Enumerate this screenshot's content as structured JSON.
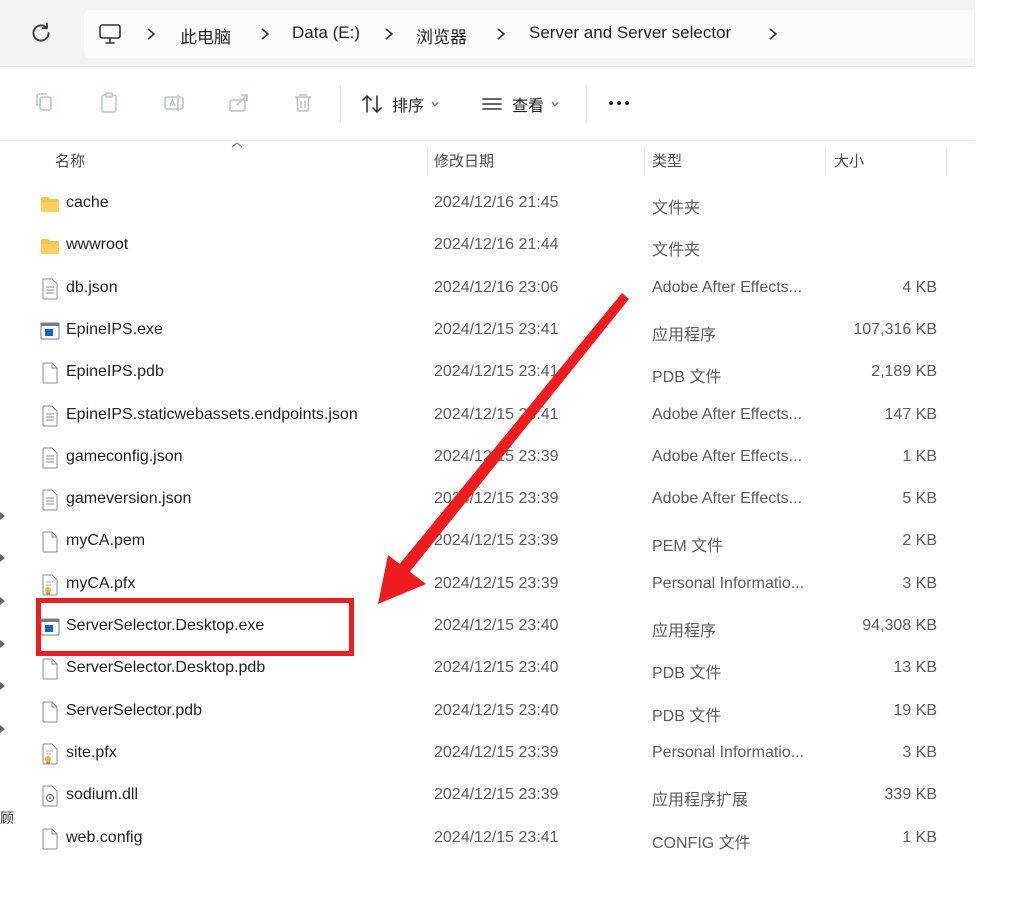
{
  "breadcrumb": [
    "此电脑",
    "Data (E:)",
    "浏览器",
    "Server and Server selector"
  ],
  "toolbar": {
    "sort_label": "排序",
    "view_label": "查看"
  },
  "columns": {
    "name": "名称",
    "modified": "修改日期",
    "type": "类型",
    "size": "大小"
  },
  "files": [
    {
      "name": "cache",
      "date": "2024/12/16 21:45",
      "type": "文件夹",
      "size": "",
      "icon": "folder-icon"
    },
    {
      "name": "wwwroot",
      "date": "2024/12/16 21:44",
      "type": "文件夹",
      "size": "",
      "icon": "folder-icon"
    },
    {
      "name": "db.json",
      "date": "2024/12/16 23:06",
      "type": "Adobe After Effects...",
      "size": "4 KB",
      "icon": "json-file-icon"
    },
    {
      "name": "EpineIPS.exe",
      "date": "2024/12/15 23:41",
      "type": "应用程序",
      "size": "107,316 KB",
      "icon": "exe-file-icon"
    },
    {
      "name": "EpineIPS.pdb",
      "date": "2024/12/15 23:41",
      "type": "PDB 文件",
      "size": "2,189 KB",
      "icon": "blank-file-icon"
    },
    {
      "name": "EpineIPS.staticwebassets.endpoints.json",
      "date": "2024/12/15 23:41",
      "type": "Adobe After Effects...",
      "size": "147 KB",
      "icon": "json-file-icon"
    },
    {
      "name": "gameconfig.json",
      "date": "2024/12/15 23:39",
      "type": "Adobe After Effects...",
      "size": "1 KB",
      "icon": "json-file-icon"
    },
    {
      "name": "gameversion.json",
      "date": "2024/12/15 23:39",
      "type": "Adobe After Effects...",
      "size": "5 KB",
      "icon": "json-file-icon"
    },
    {
      "name": "myCA.pem",
      "date": "2024/12/15 23:39",
      "type": "PEM 文件",
      "size": "2 KB",
      "icon": "blank-file-icon"
    },
    {
      "name": "myCA.pfx",
      "date": "2024/12/15 23:39",
      "type": "Personal Informatio...",
      "size": "3 KB",
      "icon": "certificate-file-icon"
    },
    {
      "name": "ServerSelector.Desktop.exe",
      "date": "2024/12/15 23:40",
      "type": "应用程序",
      "size": "94,308 KB",
      "icon": "exe-file-icon"
    },
    {
      "name": "ServerSelector.Desktop.pdb",
      "date": "2024/12/15 23:40",
      "type": "PDB 文件",
      "size": "13 KB",
      "icon": "blank-file-icon"
    },
    {
      "name": "ServerSelector.pdb",
      "date": "2024/12/15 23:40",
      "type": "PDB 文件",
      "size": "19 KB",
      "icon": "blank-file-icon"
    },
    {
      "name": "site.pfx",
      "date": "2024/12/15 23:39",
      "type": "Personal Informatio...",
      "size": "3 KB",
      "icon": "certificate-file-icon"
    },
    {
      "name": "sodium.dll",
      "date": "2024/12/15 23:39",
      "type": "应用程序扩展",
      "size": "339 KB",
      "icon": "dll-file-icon"
    },
    {
      "name": "web.config",
      "date": "2024/12/15 23:41",
      "type": "CONFIG 文件",
      "size": "1 KB",
      "icon": "blank-file-icon"
    }
  ],
  "nav_fragment": "顾",
  "colors": {
    "annotation": "#ee1c1c",
    "folder": "#f4c542",
    "exe_blue": "#1565c0"
  }
}
